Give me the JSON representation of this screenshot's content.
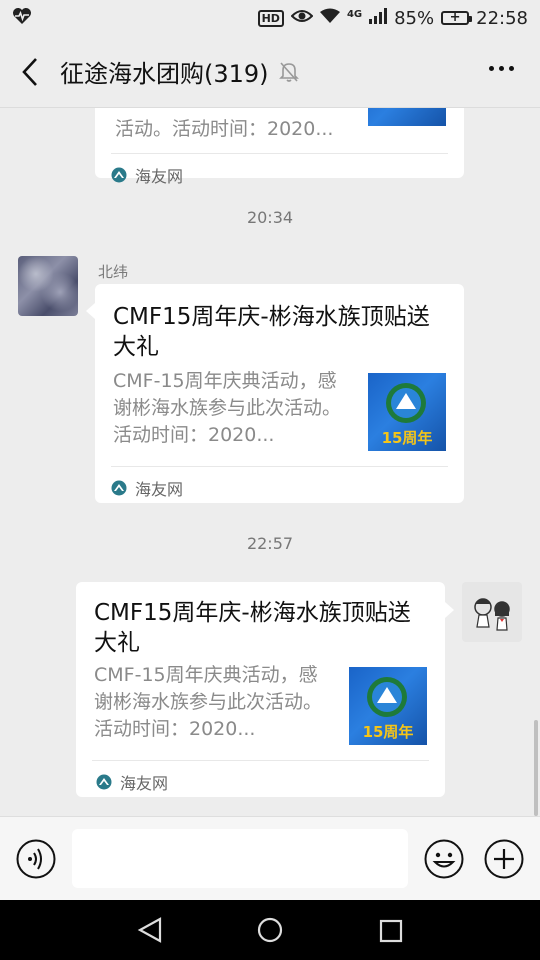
{
  "status_bar": {
    "battery_percent": "85%",
    "time": "22:58",
    "network_label": "4G",
    "hd_label": "HD"
  },
  "header": {
    "title": "征途海水团购(319)"
  },
  "messages": [
    {
      "desc_tail": "活动。活动时间：2020...",
      "source": "海友网"
    },
    {
      "timestamp": "20:34",
      "sender": "北纬",
      "title": "CMF15周年庆-彬海水族顶贴送大礼",
      "desc": "CMF-15周年庆典活动，感谢彬海水族参与此次活动。活动时间：2020...",
      "source": "海友网",
      "thumb_label": "15周年"
    },
    {
      "timestamp": "22:57",
      "title": "CMF15周年庆-彬海水族顶贴送大礼",
      "desc": "CMF-15周年庆典活动，感谢彬海水族参与此次活动。活动时间：2020...",
      "source": "海友网",
      "thumb_label": "15周年"
    }
  ],
  "colors": {
    "background": "#ededed",
    "card": "#ffffff",
    "thumb_blue": "#1a64c8",
    "source_icon": "#2a7a8a"
  }
}
